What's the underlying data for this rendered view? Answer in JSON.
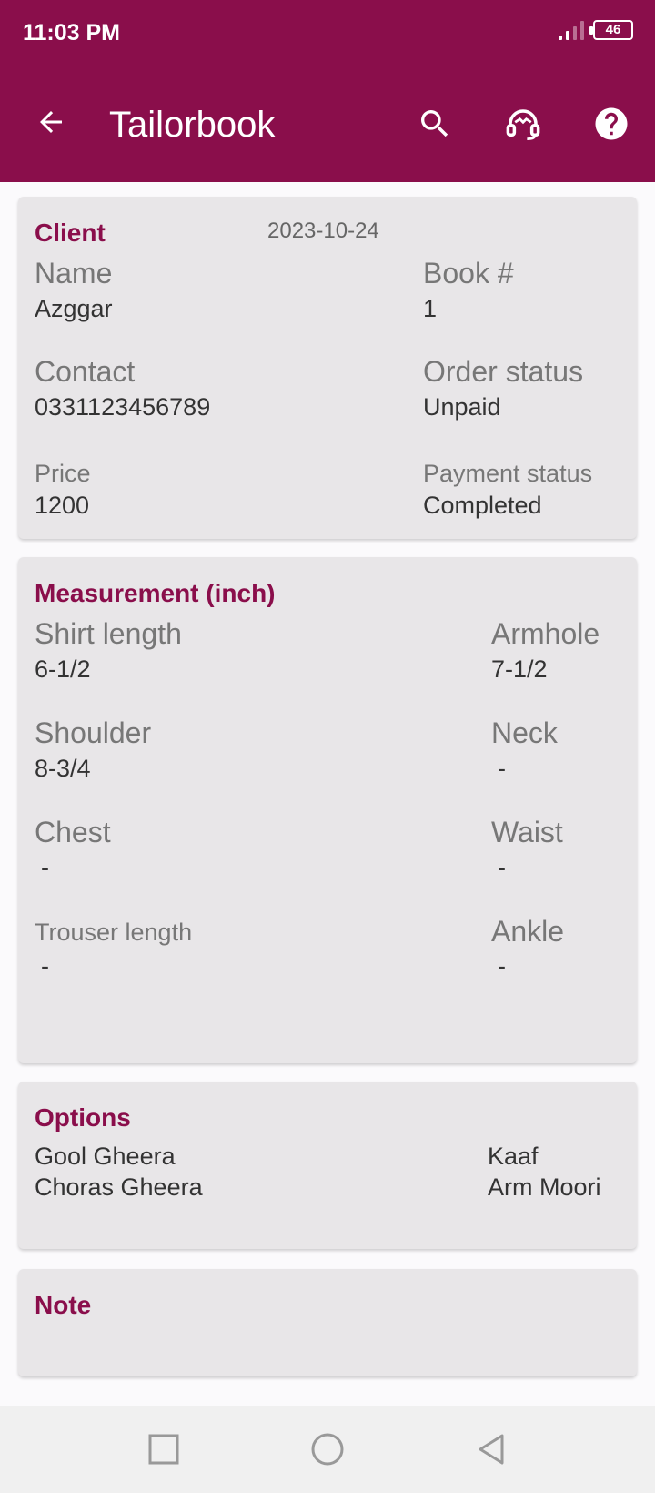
{
  "status_bar": {
    "time": "11:03 PM",
    "battery": "46"
  },
  "app_bar": {
    "title": "Tailorbook"
  },
  "client": {
    "section_title": "Client",
    "date": "2023-10-24",
    "name_label": "Name",
    "name_value": "Azggar",
    "book_label": "Book #",
    "book_value": "1",
    "contact_label": "Contact",
    "contact_value": "0331123456789",
    "order_status_label": "Order status",
    "order_status_value": "Unpaid",
    "price_label": "Price",
    "price_value": "1200",
    "payment_status_label": "Payment status",
    "payment_status_value": "Completed"
  },
  "measurement": {
    "section_title": "Measurement (inch)",
    "shirt_length_label": "Shirt length",
    "shirt_length_value": "6-1/2",
    "armhole_label": "Armhole",
    "armhole_value": "7-1/2",
    "shoulder_label": "Shoulder",
    "shoulder_value": "8-3/4",
    "neck_label": "Neck",
    "neck_value": "-",
    "chest_label": "Chest",
    "chest_value": "-",
    "waist_label": "Waist",
    "waist_value": "-",
    "trouser_length_label": "Trouser length",
    "trouser_length_value": "-",
    "ankle_label": "Ankle",
    "ankle_value": "-"
  },
  "options": {
    "section_title": "Options",
    "left": [
      "Gool Gheera",
      "Choras Gheera"
    ],
    "right": [
      "Kaaf",
      "Arm Moori"
    ]
  },
  "note": {
    "section_title": "Note"
  },
  "colors": {
    "primary": "#8a0e4b",
    "card": "#e8e6e8",
    "label": "#777777"
  }
}
